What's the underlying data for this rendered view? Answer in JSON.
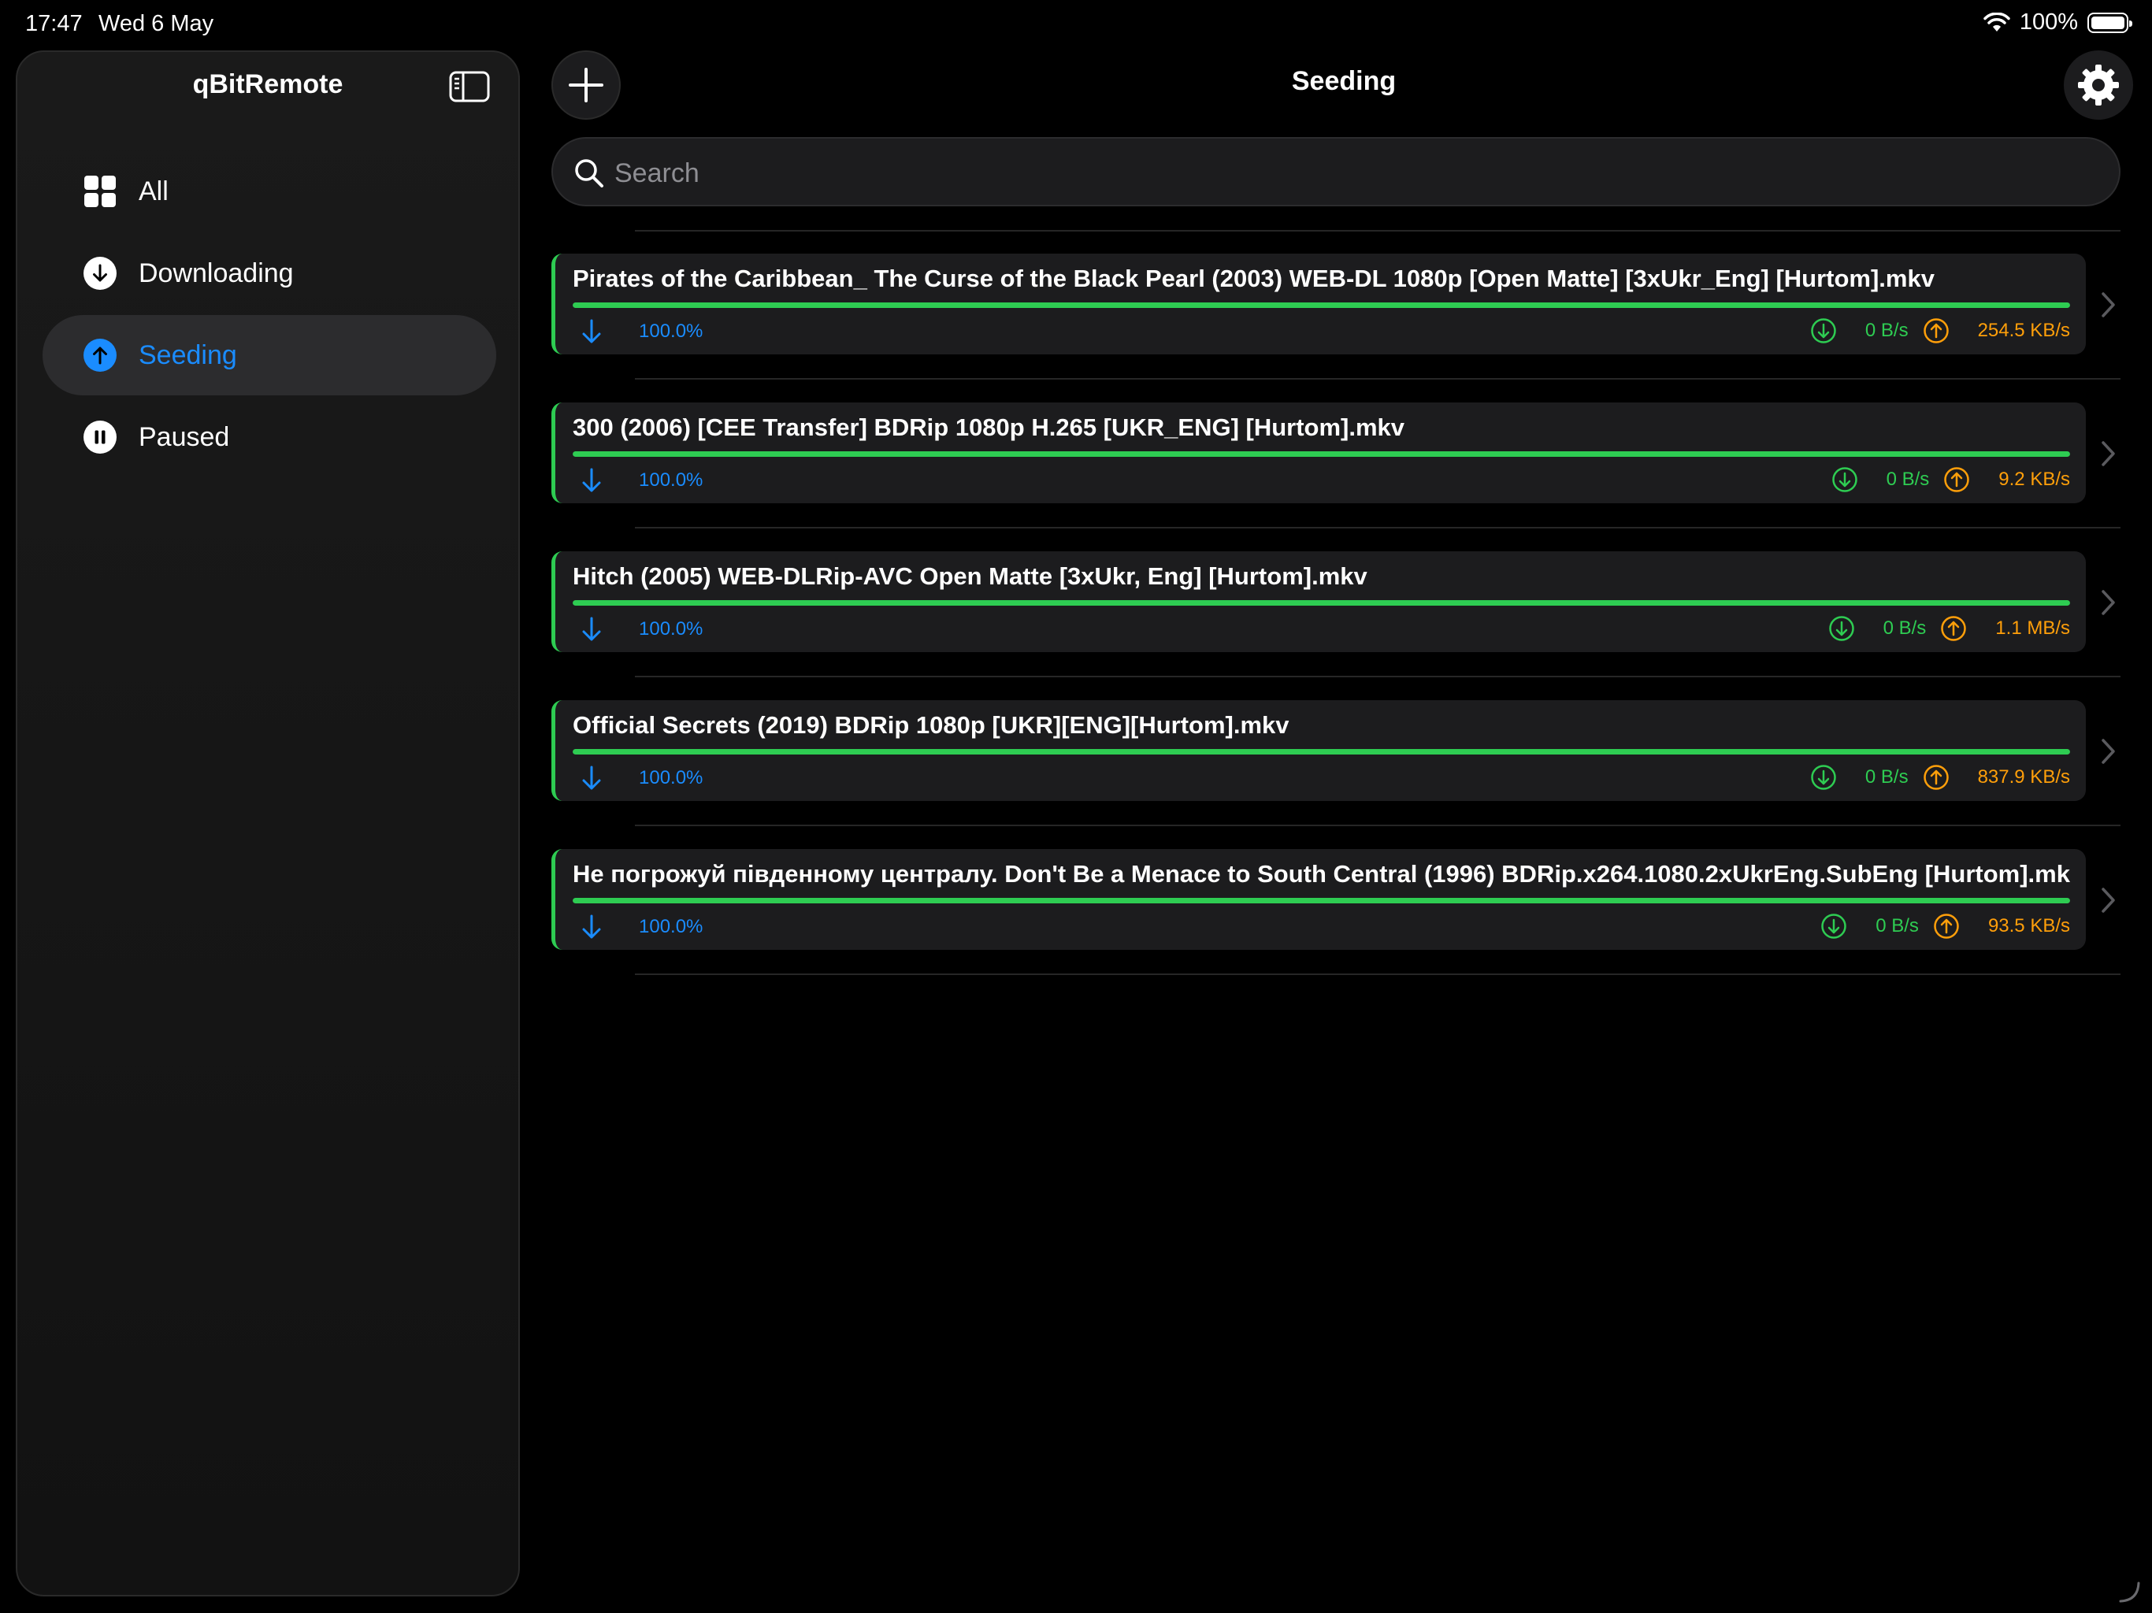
{
  "status_bar": {
    "time": "17:47",
    "date": "Wed 6 May",
    "battery": "100%"
  },
  "sidebar": {
    "title": "qBitRemote",
    "items": [
      {
        "label": "All",
        "icon": "grid-icon"
      },
      {
        "label": "Downloading",
        "icon": "arrow-down-circle-icon"
      },
      {
        "label": "Seeding",
        "icon": "arrow-up-circle-icon",
        "selected": true
      },
      {
        "label": "Paused",
        "icon": "pause-circle-icon"
      }
    ]
  },
  "header": {
    "title": "Seeding"
  },
  "search": {
    "placeholder": "Search",
    "value": ""
  },
  "torrents": [
    {
      "name": "Pirates of the Caribbean_ The Curse of the Black Pearl (2003) WEB-DL 1080p [Open Matte] [3xUkr_Eng] [Hurtom].mkv",
      "progress": "100.0%",
      "progress_fraction": 1.0,
      "dl_speed": "0 B/s",
      "ul_speed": "254.5 KB/s"
    },
    {
      "name": "300 (2006) [CEE Transfer] BDRip 1080p H.265 [UKR_ENG] [Hurtom].mkv",
      "progress": "100.0%",
      "progress_fraction": 1.0,
      "dl_speed": "0 B/s",
      "ul_speed": "9.2 KB/s"
    },
    {
      "name": "Hitch (2005) WEB-DLRip-AVC Open Matte [3xUkr, Eng] [Hurtom].mkv",
      "progress": "100.0%",
      "progress_fraction": 1.0,
      "dl_speed": "0 B/s",
      "ul_speed": "1.1 MB/s"
    },
    {
      "name": "Official Secrets (2019) BDRip 1080p [UKR][ENG][Hurtom].mkv",
      "progress": "100.0%",
      "progress_fraction": 1.0,
      "dl_speed": "0 B/s",
      "ul_speed": "837.9 KB/s"
    },
    {
      "name": "Не погрожуй південному централу. Don't Be a Menace to South Central (1996) BDRip.x264.1080.2xUkrEng.SubEng [Hurtom].mkv",
      "progress": "100.0%",
      "progress_fraction": 1.0,
      "dl_speed": "0 B/s",
      "ul_speed": "93.5 KB/s"
    }
  ],
  "colors": {
    "accent_blue": "#1a8cff",
    "seeding_green": "#2ecc52",
    "upload_orange": "#ff9f0a"
  }
}
